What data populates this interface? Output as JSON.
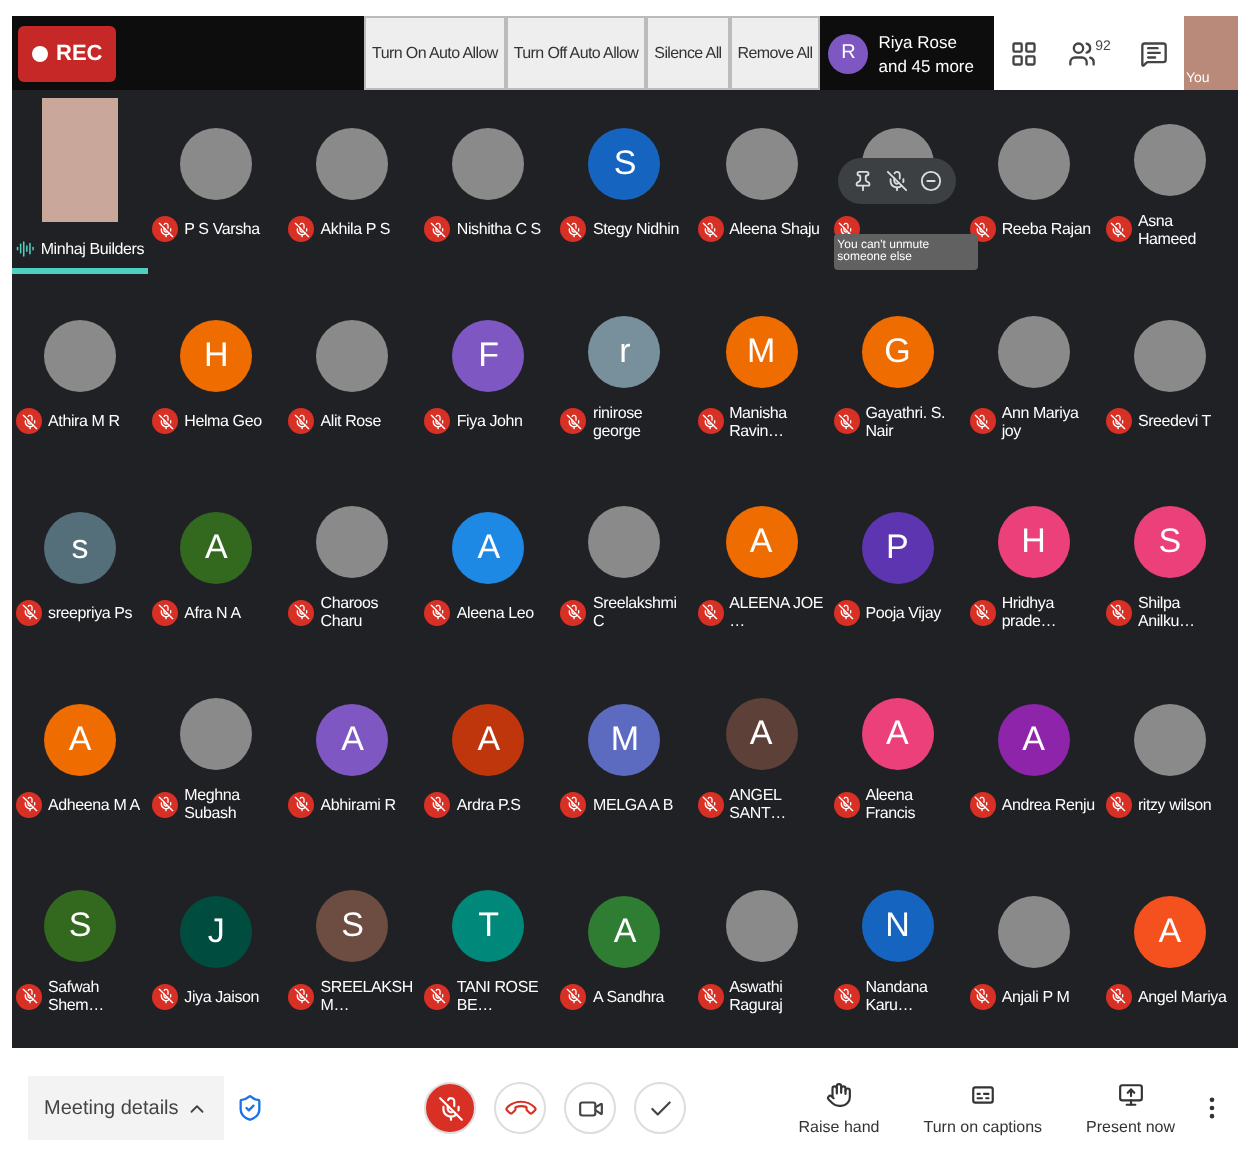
{
  "top_bar": {
    "rec_label": "REC",
    "buttons": [
      "Turn On Auto Allow",
      "Turn Off Auto Allow",
      "Silence All",
      "Remove All"
    ],
    "presenter": {
      "initial": "R",
      "color": "#7e57c2",
      "name": "Riya Rose",
      "more": "and 45 more"
    },
    "participant_count": "92",
    "self_label": "You"
  },
  "participants": [
    {
      "name": "Minhaj Builders",
      "kind": "video",
      "muted": false,
      "speaking": true
    },
    {
      "name": "P S Varsha",
      "kind": "photo",
      "muted": true
    },
    {
      "name": "Akhila P S",
      "kind": "photo",
      "muted": true
    },
    {
      "name": "Nishitha C S",
      "kind": "photo",
      "muted": true
    },
    {
      "name": "Stegy Nidhin",
      "kind": "letter",
      "initial": "S",
      "color": "#1565c0",
      "muted": true
    },
    {
      "name": "Aleena Shaju",
      "kind": "photo",
      "muted": true
    },
    {
      "kind": "photo",
      "muted": true,
      "hovered": true,
      "tooltip": "You can't unmute someone else"
    },
    {
      "name": "Reeba Rajan",
      "kind": "photo",
      "muted": true
    },
    {
      "name": "Asna Hameed",
      "kind": "photo",
      "muted": true
    },
    {
      "name": "Athira M R",
      "kind": "photo",
      "muted": true
    },
    {
      "name": "Helma Geo",
      "kind": "letter",
      "initial": "H",
      "color": "#ef6c00",
      "muted": true
    },
    {
      "name": "Alit Rose",
      "kind": "photo",
      "muted": true
    },
    {
      "name": "Fiya John",
      "kind": "letter",
      "initial": "F",
      "color": "#7e57c2",
      "muted": true
    },
    {
      "name": "rinirose george",
      "kind": "letter",
      "initial": "r",
      "color": "#78909c",
      "muted": true
    },
    {
      "name": "Manisha Ravin…",
      "kind": "letter",
      "initial": "M",
      "color": "#ef6c00",
      "muted": true
    },
    {
      "name": "Gayathri. S. Nair",
      "kind": "letter",
      "initial": "G",
      "color": "#ef6c00",
      "muted": true
    },
    {
      "name": "Ann Mariya joy",
      "kind": "photo",
      "muted": true
    },
    {
      "name": "Sreedevi T",
      "kind": "photo",
      "muted": true
    },
    {
      "name": "sreepriya Ps",
      "kind": "letter",
      "initial": "s",
      "color": "#546e7a",
      "muted": true
    },
    {
      "name": "Afra N A",
      "kind": "letter",
      "initial": "A",
      "color": "#33691e",
      "muted": true
    },
    {
      "name": "Charoos Charu",
      "kind": "photo",
      "muted": true
    },
    {
      "name": "Aleena Leo",
      "kind": "letter",
      "initial": "A",
      "color": "#1e88e5",
      "muted": true
    },
    {
      "name": "Sreelakshmi C",
      "kind": "photo",
      "muted": true
    },
    {
      "name": "ALEENA JOE …",
      "kind": "letter",
      "initial": "A",
      "color": "#ef6c00",
      "muted": true
    },
    {
      "name": "Pooja Vijay",
      "kind": "letter",
      "initial": "P",
      "color": "#5e35b1",
      "muted": true
    },
    {
      "name": "Hridhya prade…",
      "kind": "letter",
      "initial": "H",
      "color": "#ec407a",
      "muted": true
    },
    {
      "name": "Shilpa Anilku…",
      "kind": "letter",
      "initial": "S",
      "color": "#ec407a",
      "muted": true
    },
    {
      "name": "Adheena M A",
      "kind": "letter",
      "initial": "A",
      "color": "#ef6c00",
      "muted": true
    },
    {
      "name": "Meghna Subash",
      "kind": "photo",
      "muted": true
    },
    {
      "name": "Abhirami R",
      "kind": "letter",
      "initial": "A",
      "color": "#7e57c2",
      "muted": true
    },
    {
      "name": "Ardra P.S",
      "kind": "letter",
      "initial": "A",
      "color": "#bf360c",
      "muted": true
    },
    {
      "name": "MELGA A B",
      "kind": "letter",
      "initial": "M",
      "color": "#5c6bc0",
      "muted": true
    },
    {
      "name": "ANGEL SANT…",
      "kind": "letter",
      "initial": "A",
      "color": "#5d4037",
      "muted": true
    },
    {
      "name": "Aleena Francis",
      "kind": "letter",
      "initial": "A",
      "color": "#ec407a",
      "muted": true
    },
    {
      "name": "Andrea Renju",
      "kind": "letter",
      "initial": "A",
      "color": "#8e24aa",
      "muted": true
    },
    {
      "name": "ritzy wilson",
      "kind": "photo",
      "muted": true
    },
    {
      "name": "Safwah Shem…",
      "kind": "letter",
      "initial": "S",
      "color": "#33691e",
      "muted": true
    },
    {
      "name": "Jiya Jaison",
      "kind": "letter",
      "initial": "J",
      "color": "#004d40",
      "muted": true
    },
    {
      "name": "SREELAKSHM…",
      "kind": "letter",
      "initial": "S",
      "color": "#6d4c41",
      "muted": true
    },
    {
      "name": "TANI ROSE BE…",
      "kind": "letter",
      "initial": "T",
      "color": "#00897b",
      "muted": true
    },
    {
      "name": "A Sandhra",
      "kind": "letter",
      "initial": "A",
      "color": "#2e7d32",
      "muted": true
    },
    {
      "name": "Aswathi Raguraj",
      "kind": "photo",
      "muted": true
    },
    {
      "name": "Nandana Karu…",
      "kind": "letter",
      "initial": "N",
      "color": "#1565c0",
      "muted": true
    },
    {
      "name": "Anjali P M",
      "kind": "photo",
      "muted": true
    },
    {
      "name": "Angel Mariya",
      "kind": "letter",
      "initial": "A",
      "color": "#f4511e",
      "muted": true
    }
  ],
  "bottom_bar": {
    "meeting_details": "Meeting details",
    "mic_on": false,
    "camera_on": true,
    "actions": [
      {
        "kind": "hand",
        "label": "Raise hand"
      },
      {
        "kind": "captions",
        "label": "Turn on captions"
      },
      {
        "kind": "present",
        "label": "Present now"
      }
    ]
  }
}
